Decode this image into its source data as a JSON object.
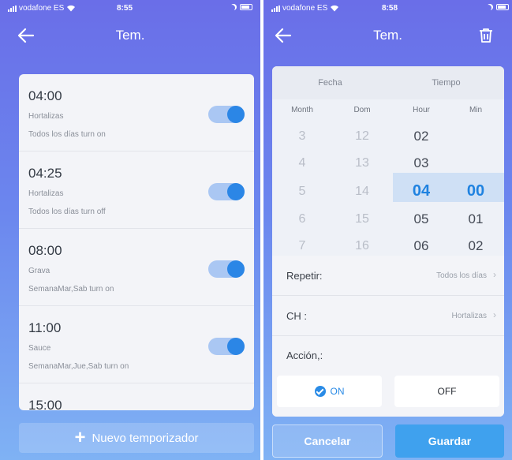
{
  "left": {
    "status": {
      "carrier": "vodafone ES",
      "time": "8:55"
    },
    "nav": {
      "title": "Tem."
    },
    "timers": [
      {
        "time": "04:00",
        "channel": "Hortalizas",
        "repeat": "Todos los días turn on",
        "enabled": true
      },
      {
        "time": "04:25",
        "channel": "Hortalizas",
        "repeat": "Todos los días turn off",
        "enabled": true
      },
      {
        "time": "08:00",
        "channel": "Grava",
        "repeat": "SemanaMar,Sab turn on",
        "enabled": true
      },
      {
        "time": "11:00",
        "channel": "Sauce",
        "repeat": "SemanaMar,Jue,Sab turn on",
        "enabled": true
      },
      {
        "time": "15:00",
        "channel": "",
        "repeat": "",
        "enabled": true
      }
    ],
    "add_button_label": "Nuevo temporizador"
  },
  "right": {
    "status": {
      "carrier": "vodafone ES",
      "time": "8:58"
    },
    "nav": {
      "title": "Tem."
    },
    "tabs": [
      "Fecha",
      "Tiempo"
    ],
    "picker": {
      "columns": [
        {
          "header": "Month",
          "values": [
            "3",
            "4",
            "5",
            "6",
            "7"
          ]
        },
        {
          "header": "Dom",
          "values": [
            "12",
            "13",
            "14",
            "15",
            "16"
          ]
        },
        {
          "header": "Hour",
          "values": [
            "02",
            "03",
            "04",
            "05",
            "06"
          ],
          "selected": "04"
        },
        {
          "header": "Min",
          "values": [
            "",
            "",
            "00",
            "01",
            "02"
          ],
          "selected": "00"
        }
      ]
    },
    "repeat": {
      "label": "Repetir:",
      "value": "Todos los días"
    },
    "channel": {
      "label": "CH :",
      "value": "Hortalizas"
    },
    "action": {
      "label": "Acción,:",
      "on_label": "ON",
      "off_label": "OFF",
      "selected": "ON"
    },
    "cancel_label": "Cancelar",
    "save_label": "Guardar"
  },
  "colors": {
    "accent": "#2b86e6",
    "gradient_top": "#6a6ee8",
    "gradient_bottom": "#7fb2f4"
  }
}
